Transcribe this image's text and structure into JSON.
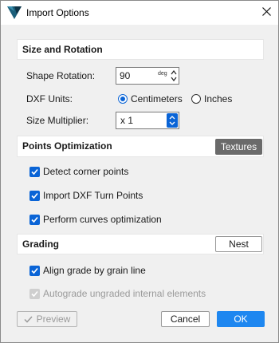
{
  "window": {
    "title": "Import Options"
  },
  "size_rotation": {
    "title": "Size and Rotation",
    "shape_rotation_label": "Shape Rotation:",
    "shape_rotation_value": "90",
    "shape_rotation_unit": "deg",
    "dxf_units_label": "DXF Units:",
    "units": [
      {
        "label": "Centimeters",
        "selected": true
      },
      {
        "label": "Inches",
        "selected": false
      }
    ],
    "size_multiplier_label": "Size Multiplier:",
    "size_multiplier_value": "x 1"
  },
  "points_optimization": {
    "title": "Points Optimization",
    "textures_button": "Textures",
    "options": [
      {
        "label": "Detect corner points",
        "checked": true
      },
      {
        "label": "Import DXF Turn Points",
        "checked": true
      },
      {
        "label": "Perform curves optimization",
        "checked": true
      }
    ]
  },
  "grading": {
    "title": "Grading",
    "nest_button": "Nest",
    "options": [
      {
        "label": "Align grade by grain line",
        "checked": true,
        "enabled": true
      },
      {
        "label": "Autograde ungraded internal elements",
        "checked": true,
        "enabled": false
      }
    ]
  },
  "footer": {
    "preview": "Preview",
    "cancel": "Cancel",
    "ok": "OK"
  },
  "colors": {
    "accent": "#0a64d6",
    "ok_button": "#1e87f0",
    "textures_button": "#6a6a6a"
  }
}
